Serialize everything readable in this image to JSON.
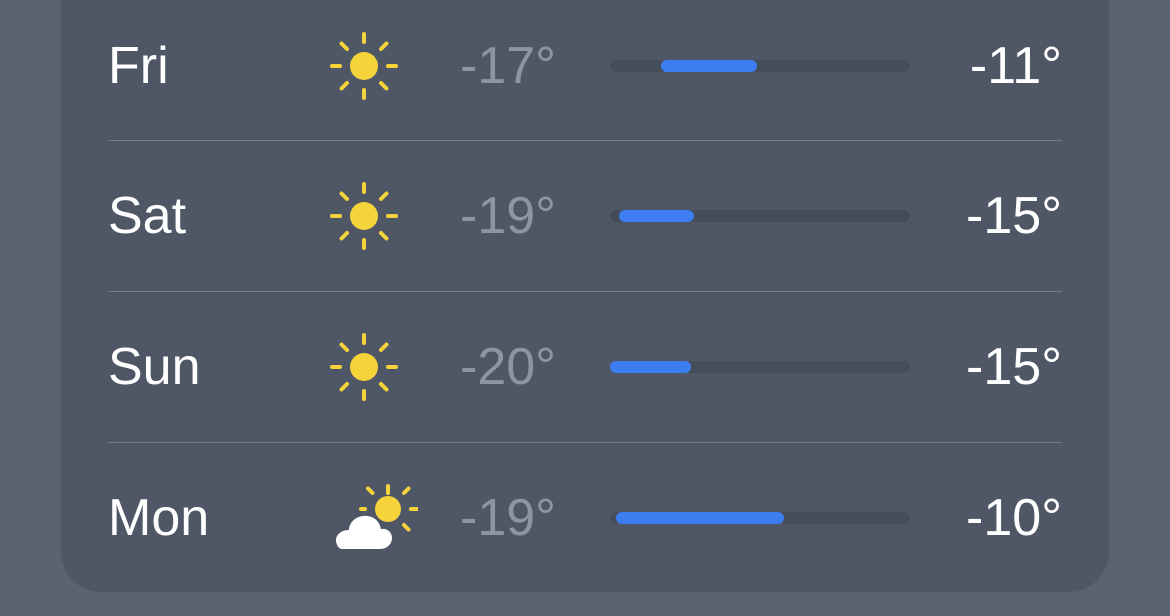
{
  "colors": {
    "background": "#5c6270",
    "card": "#4f5766",
    "accent_bar": "#3c7ef2",
    "sun": "#f5d33b"
  },
  "forecast": [
    {
      "day": "Fri",
      "icon": "sun-icon",
      "low": "-17°",
      "high": "-11°",
      "range_start": 0.17,
      "range_end": 0.49
    },
    {
      "day": "Sat",
      "icon": "sun-icon",
      "low": "-19°",
      "high": "-15°",
      "range_start": 0.03,
      "range_end": 0.28
    },
    {
      "day": "Sun",
      "icon": "sun-icon",
      "low": "-20°",
      "high": "-15°",
      "range_start": 0.0,
      "range_end": 0.27
    },
    {
      "day": "Mon",
      "icon": "partly-cloudy-icon",
      "low": "-19°",
      "high": "-10°",
      "range_start": 0.02,
      "range_end": 0.58
    }
  ]
}
